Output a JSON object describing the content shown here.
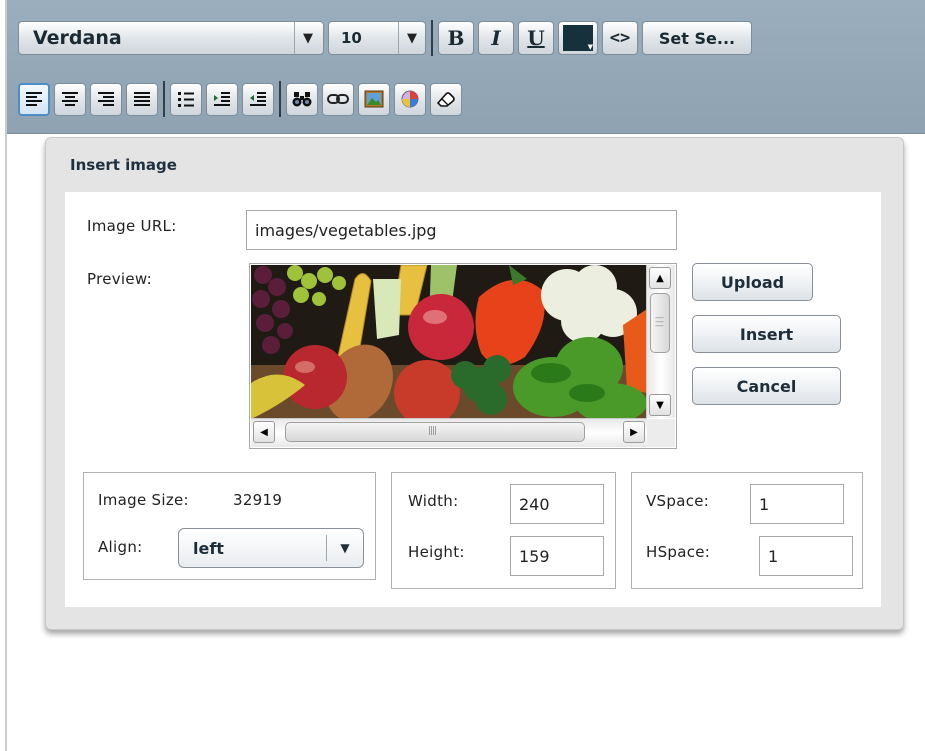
{
  "toolbar": {
    "font": "Verdana",
    "size": "10",
    "bold_label": "B",
    "italic_label": "I",
    "underline_label": "U",
    "code_label": "<>",
    "set_label": "Set Se...",
    "color": "#16303c",
    "icons": [
      "align-left-icon",
      "align-center-icon",
      "align-right-icon",
      "align-justify-icon",
      "bullet-list-icon",
      "indent-icon",
      "outdent-icon",
      "find-icon",
      "link-icon",
      "insert-image-icon",
      "insert-object-icon",
      "eraser-icon"
    ]
  },
  "dialog": {
    "title": "Insert image",
    "image_url_label": "Image URL:",
    "image_url": "images/vegetables.jpg",
    "preview_label": "Preview:",
    "upload_label": "Upload",
    "insert_label": "Insert",
    "cancel_label": "Cancel",
    "image_size_label": "Image Size:",
    "image_size": "32919",
    "align_label": "Align:",
    "align_value": "left",
    "width_label": "Width:",
    "width": "240",
    "height_label": "Height:",
    "height": "159",
    "vspace_label": "VSpace:",
    "vspace": "1",
    "hspace_label": "HSpace:",
    "hspace": "1"
  }
}
